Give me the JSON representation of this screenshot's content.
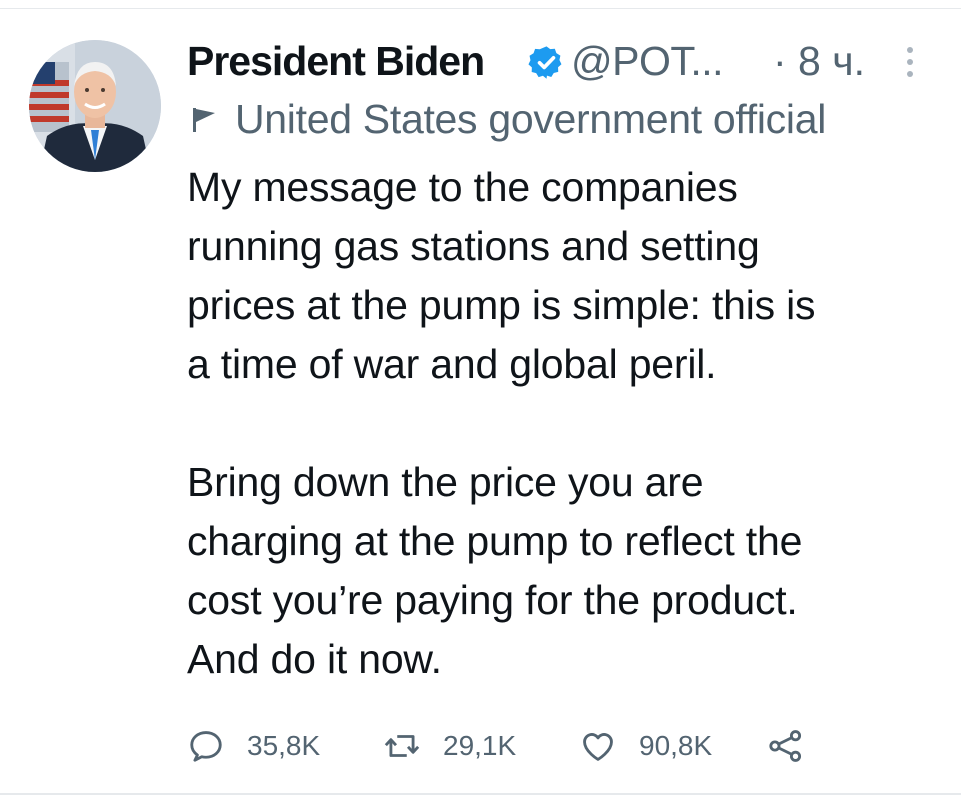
{
  "tweet": {
    "display_name": "President Biden",
    "handle": "@POT...",
    "time": "· 8 ч.",
    "label": "United States government official",
    "body_lines": [
      "My message to the companies",
      "running gas stations and setting",
      "prices at the pump is simple: this is",
      "a time of war and global peril.",
      "",
      "Bring down the price you are",
      "charging at the pump to reflect the",
      "cost you’re paying for the product.",
      "And do it now."
    ],
    "actions": {
      "replies": "35,8K",
      "retweets": "29,1K",
      "likes": "90,8K"
    }
  },
  "icons": {
    "verified": "verified-badge-icon",
    "more": "more-options-icon",
    "flag": "government-flag-icon",
    "reply": "reply-icon",
    "retweet": "retweet-icon",
    "like": "heart-icon",
    "share": "share-icon"
  },
  "colors": {
    "verified_blue": "#1d9bf0",
    "text_primary": "#0f1419",
    "text_secondary": "#536471"
  }
}
